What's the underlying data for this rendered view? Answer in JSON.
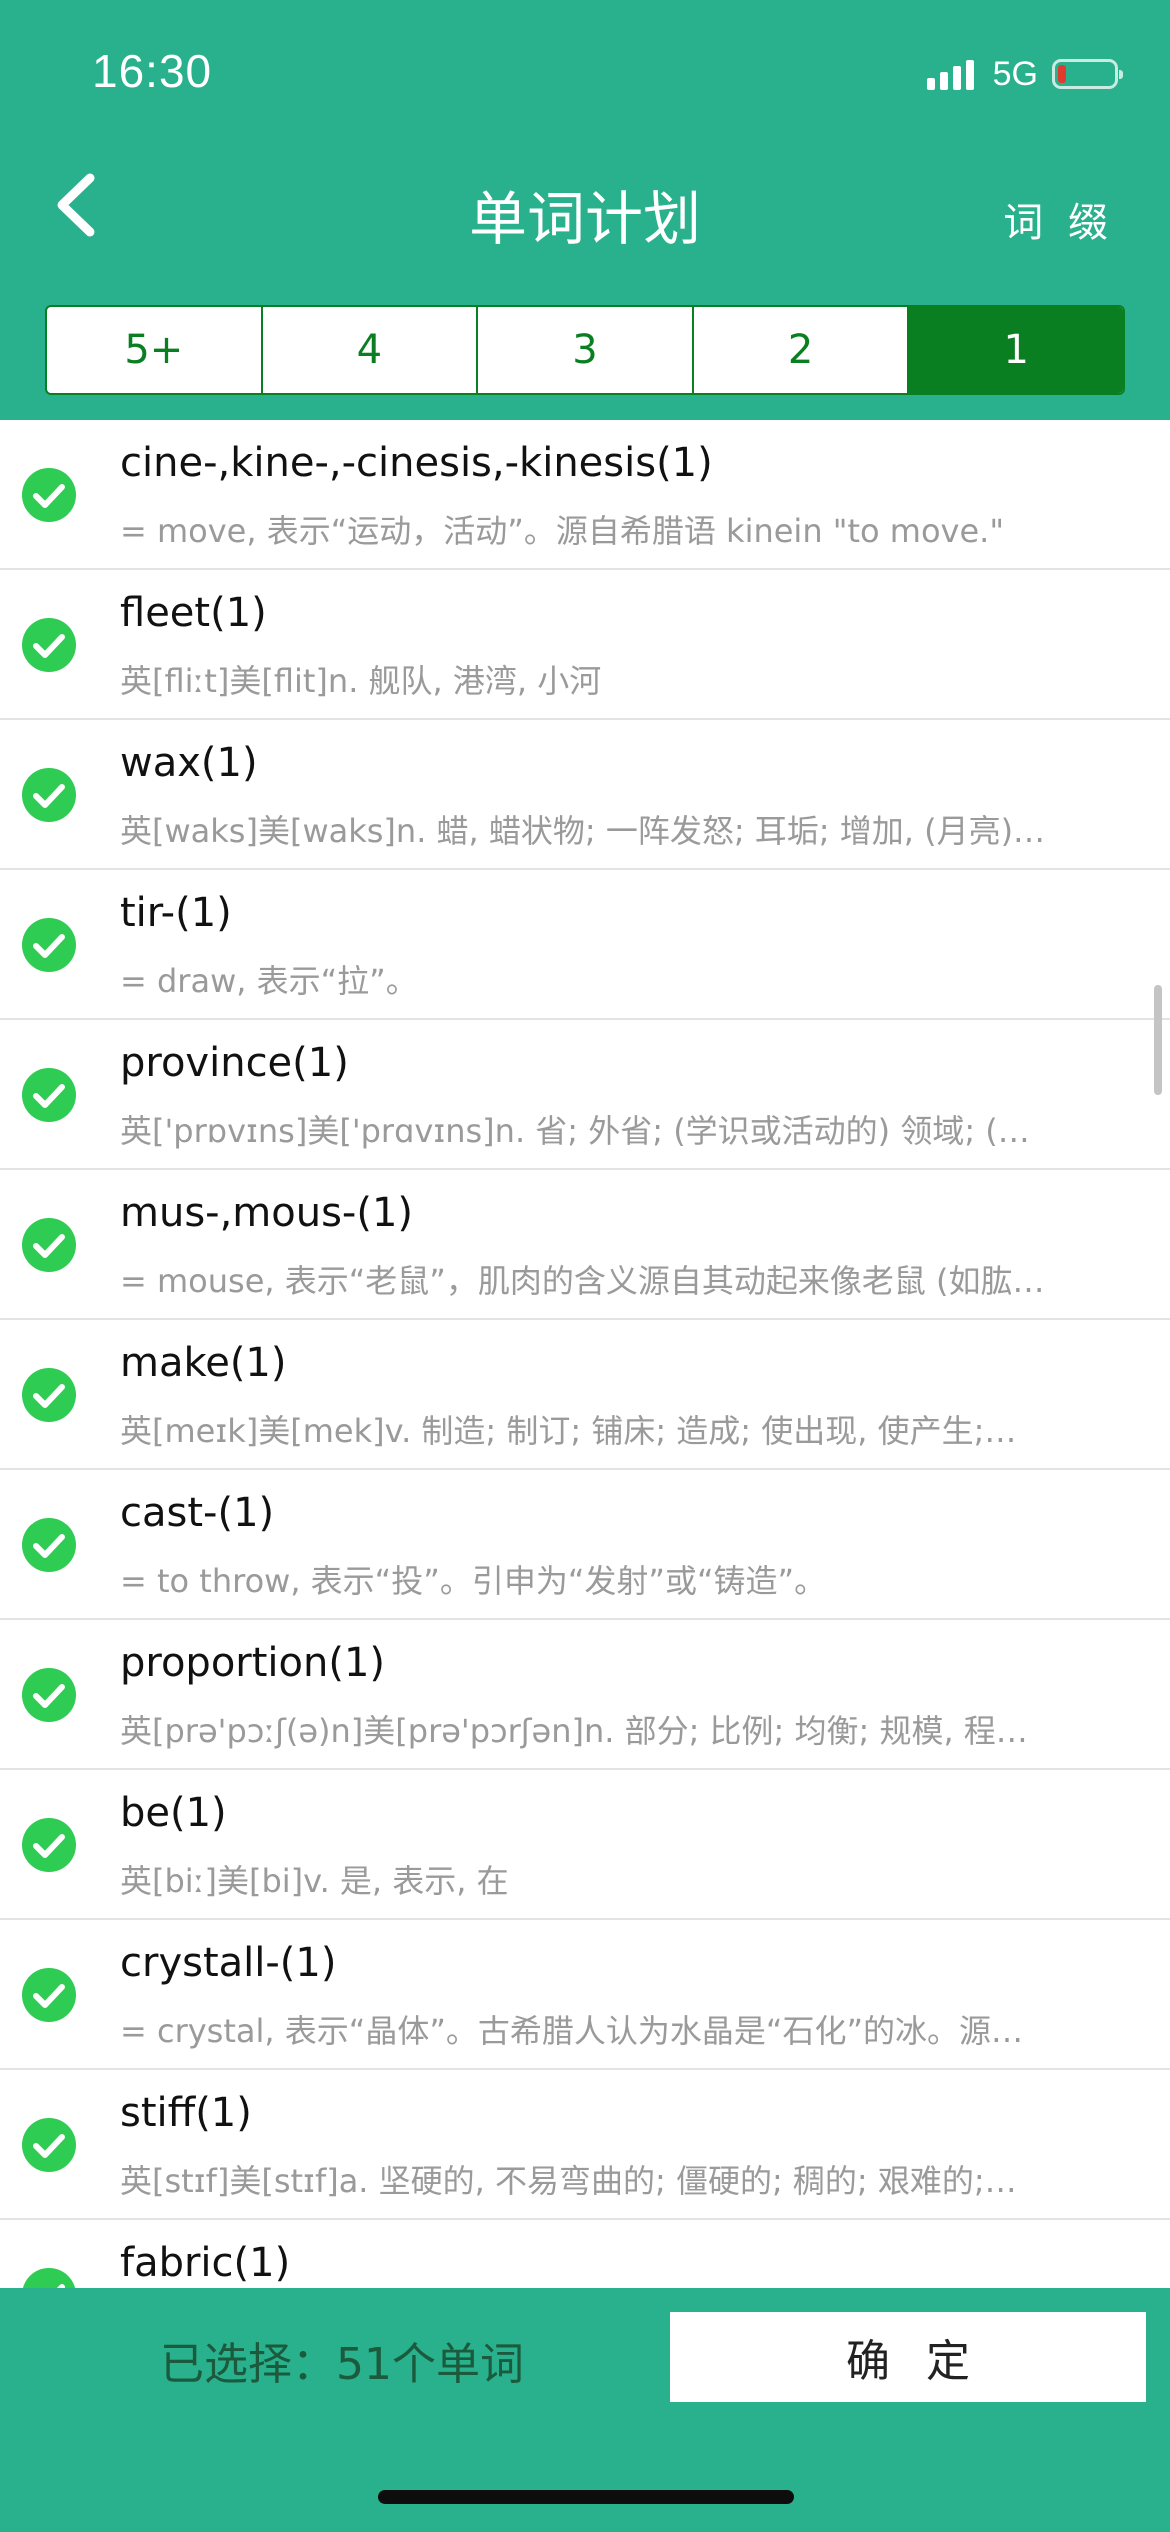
{
  "status_bar": {
    "time": "16:30",
    "network": "5G",
    "icons": [
      "signal-icon",
      "battery-icon"
    ]
  },
  "nav": {
    "title": "单词计划",
    "right_label": "词 缀",
    "back_icon": "chevron-left-icon"
  },
  "tabs": [
    {
      "label": "5+",
      "active": false
    },
    {
      "label": "4",
      "active": false
    },
    {
      "label": "3",
      "active": false
    },
    {
      "label": "2",
      "active": false
    },
    {
      "label": "1",
      "active": true
    }
  ],
  "items": [
    {
      "word": "cine-,kine-,-cinesis,-kinesis(1)",
      "desc": "= move, 表示“运动，活动”。源自希腊语 kinein \"to move.\"",
      "checked": true
    },
    {
      "word": "fleet(1)",
      "desc": "英[fliːt]美[flit]n. 舰队, 港湾, 小河",
      "checked": true
    },
    {
      "word": "wax(1)",
      "desc": "英[waks]美[waks]n. 蜡, 蜡状物; 一阵发怒; 耳垢; 增加, (月亮)…",
      "checked": true
    },
    {
      "word": "tir-(1)",
      "desc": "= draw, 表示“拉”。",
      "checked": true
    },
    {
      "word": "province(1)",
      "desc": "英['prɒvɪns]美['prɑvɪns]n. 省; 外省; (学识或活动的) 领域; (…",
      "checked": true
    },
    {
      "word": "mus-,mous-(1)",
      "desc": "= mouse, 表示“老鼠”，肌肉的含义源自其动起来像老鼠 (如肱…",
      "checked": true
    },
    {
      "word": "make(1)",
      "desc": "英[meɪk]美[mek]v. 制造; 制订; 铺床; 造成; 使出现, 使产生;…",
      "checked": true
    },
    {
      "word": "cast-(1)",
      "desc": "= to throw, 表示“投”。引申为“发射”或“铸造”。",
      "checked": true
    },
    {
      "word": "proportion(1)",
      "desc": "英[prə'pɔːʃ(ə)n]美[prə'pɔrʃən]n. 部分; 比例; 均衡; 规模, 程…",
      "checked": true
    },
    {
      "word": "be(1)",
      "desc": "英[biː]美[bi]v. 是, 表示, 在",
      "checked": true
    },
    {
      "word": "crystall-(1)",
      "desc": "= crystal, 表示“晶体”。古希腊人认为水晶是“石化”的冰。源…",
      "checked": true
    },
    {
      "word": "stiff(1)",
      "desc": "英[stɪf]美[stɪf]a. 坚硬的, 不易弯曲的; 僵硬的; 稠的; 艰难的;…",
      "checked": true
    },
    {
      "word": "fabric(1)",
      "desc": "",
      "checked": true
    }
  ],
  "footer": {
    "selected_text": "已选择：51个单词",
    "confirm_label": "确定"
  },
  "colors": {
    "header_bg": "#29b08c",
    "accent": "#0a7f22",
    "check": "#2ecc52"
  }
}
